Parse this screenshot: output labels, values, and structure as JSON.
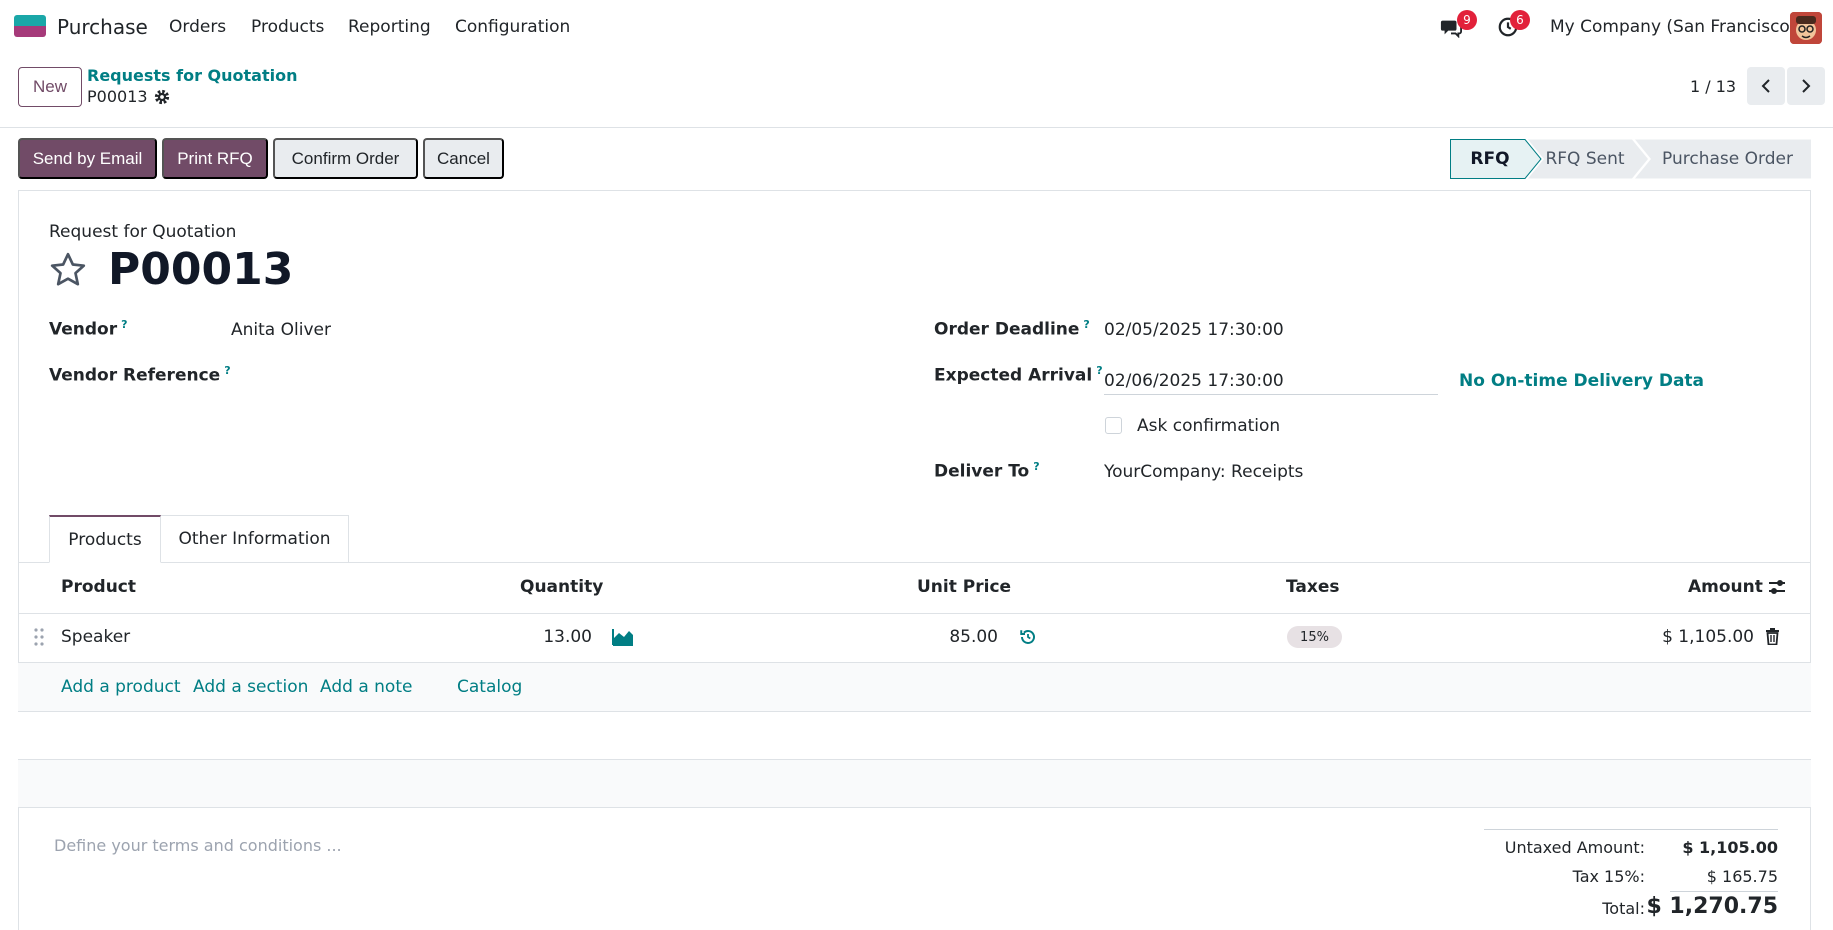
{
  "navbar": {
    "app_name": "Purchase",
    "menu": [
      "Orders",
      "Products",
      "Reporting",
      "Configuration"
    ],
    "messages_count": "9",
    "activities_count": "6",
    "company": "My Company (San Francisco)"
  },
  "control": {
    "new_label": "New",
    "breadcrumb_parent": "Requests for Quotation",
    "breadcrumb_current": "P00013",
    "pager": "1 / 13"
  },
  "actions": {
    "send_email": "Send by Email",
    "print_rfq": "Print RFQ",
    "confirm": "Confirm Order",
    "cancel": "Cancel"
  },
  "statusbar": [
    "RFQ",
    "RFQ Sent",
    "Purchase Order"
  ],
  "form": {
    "doc_label": "Request for Quotation",
    "doc_name": "P00013",
    "vendor_label": "Vendor",
    "vendor_value": "Anita Oliver",
    "vendor_ref_label": "Vendor Reference",
    "deadline_label": "Order Deadline",
    "deadline_value": "02/05/2025 17:30:00",
    "arrival_label": "Expected Arrival",
    "arrival_value": "02/06/2025 17:30:00",
    "ontime_link": "No On-time Delivery Data",
    "ask_confirmation": "Ask confirmation",
    "deliver_label": "Deliver To",
    "deliver_value": "YourCompany: Receipts",
    "help_mark": "?"
  },
  "tabs": [
    "Products",
    "Other Information"
  ],
  "table": {
    "headers": {
      "product": "Product",
      "quantity": "Quantity",
      "unit_price": "Unit Price",
      "taxes": "Taxes",
      "amount": "Amount"
    },
    "rows": [
      {
        "product": "Speaker",
        "quantity": "13.00",
        "unit_price": "85.00",
        "tax": "15%",
        "amount": "$ 1,105.00"
      }
    ],
    "add_product": "Add a product",
    "add_section": "Add a section",
    "add_note": "Add a note",
    "catalog": "Catalog"
  },
  "footer": {
    "terms_placeholder": "Define your terms and conditions ...",
    "untaxed_label": "Untaxed Amount:",
    "untaxed_value": "$ 1,105.00",
    "tax_label": "Tax 15%:",
    "tax_value": "$ 165.75",
    "total_label": "Total:",
    "total_value": "$ 1,270.75"
  },
  "colors": {
    "primary": "#714b67",
    "teal": "#017e84",
    "badge": "#e2213a"
  }
}
